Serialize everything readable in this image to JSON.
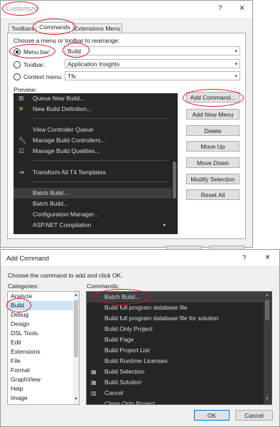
{
  "customize": {
    "title": "Customize",
    "help": "?",
    "close": "×",
    "tabs": [
      "Toolbars",
      "Commands",
      "Extensions Menu"
    ],
    "instruction": "Choose a menu or toolbar to rearrange:",
    "menubar_label": "Menu bar:",
    "menubar_value": "Build",
    "toolbar_label": "Toolbar:",
    "toolbar_value": "Application Insights",
    "context_label": "Context menu:",
    "context_value": "Tfs",
    "preview_label": "Preview:",
    "preview_items": [
      "Queue New Build...",
      "New Build Definition...",
      "View Controller Queue",
      "Manage Build Controllers...",
      "Manage Build Qualities...",
      "Transform All T4 Templates",
      "Batch Build...",
      "Batch Build...",
      "Configuration Manager...",
      "ASP.NET Compilation"
    ],
    "buttons": {
      "add_command": "Add Command...",
      "add_new_menu": "Add New Menu",
      "delete": "Delete",
      "move_up": "Move Up",
      "move_down": "Move Down",
      "modify_selection": "Modify Selection",
      "reset_all": "Reset All"
    }
  },
  "add_command": {
    "title": "Add Command",
    "help": "?",
    "close": "×",
    "instruction": "Choose the command to add and click OK.",
    "categories_label": "Categories:",
    "commands_label": "Commands:",
    "categories": [
      "Analyze",
      "Build",
      "Debug",
      "Design",
      "DSL Tools",
      "Edit",
      "Extensions",
      "File",
      "Format",
      "GraphView",
      "Help",
      "Image"
    ],
    "commands": [
      "Batch Build...",
      "Build full program database file",
      "Build full program database file for solution",
      "Build Only Project",
      "Build Page",
      "Build Project List",
      "Build Runtime Licenses",
      "Build Selection",
      "Build Solution",
      "Cancel",
      "Clean Only Project"
    ],
    "ok": "OK",
    "cancel": "Cancel"
  }
}
